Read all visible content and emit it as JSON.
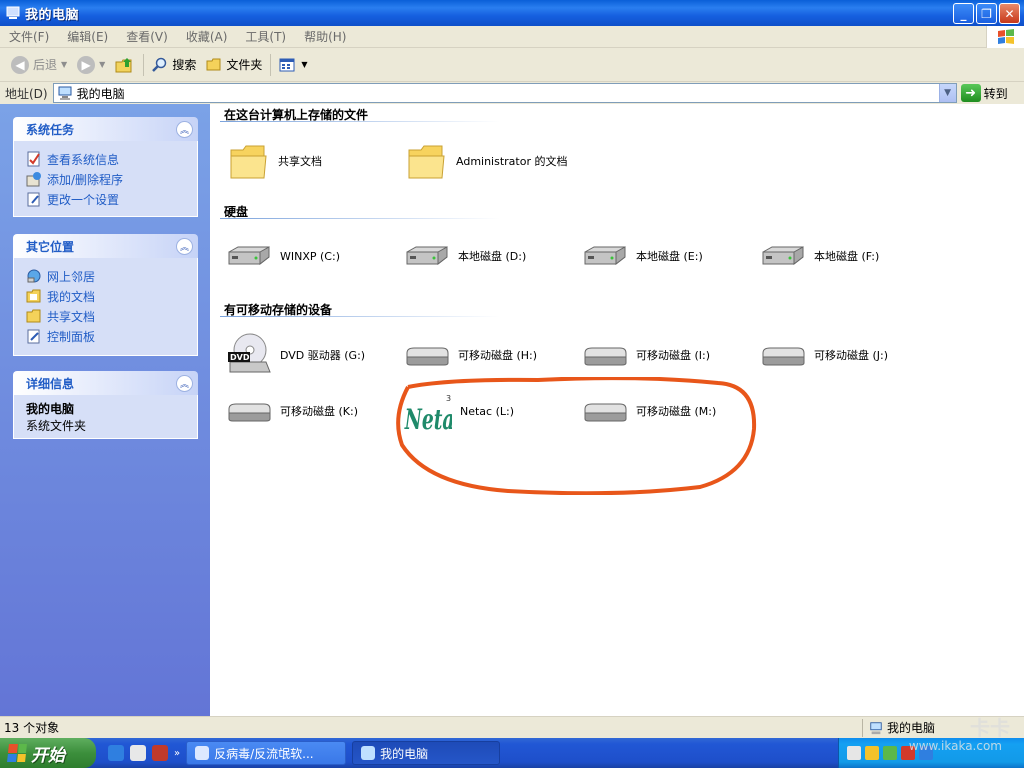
{
  "window": {
    "title": "我的电脑"
  },
  "menu": [
    "文件(F)",
    "编辑(E)",
    "查看(V)",
    "收藏(A)",
    "工具(T)",
    "帮助(H)"
  ],
  "toolbar": {
    "back": "后退",
    "search": "搜索",
    "folders": "文件夹"
  },
  "address": {
    "label": "地址(D)",
    "value": "我的电脑",
    "go": "转到"
  },
  "sidebar": {
    "system_tasks": {
      "title": "系统任务",
      "items": [
        "查看系统信息",
        "添加/删除程序",
        "更改一个设置"
      ]
    },
    "other_places": {
      "title": "其它位置",
      "items": [
        "网上邻居",
        "我的文档",
        "共享文档",
        "控制面板"
      ]
    },
    "details": {
      "title": "详细信息",
      "name": "我的电脑",
      "desc": "系统文件夹"
    }
  },
  "groups": {
    "stored_files": {
      "title": "在这台计算机上存储的文件",
      "items": [
        "共享文档",
        "Administrator 的文档"
      ]
    },
    "hard_disks": {
      "title": "硬盘",
      "items": [
        "WINXP (C:)",
        "本地磁盘 (D:)",
        "本地磁盘 (E:)",
        "本地磁盘 (F:)"
      ]
    },
    "removable": {
      "title": "有可移动存储的设备",
      "items": [
        "DVD 驱动器 (G:)",
        "可移动磁盘 (H:)",
        "可移动磁盘 (I:)",
        "可移动磁盘 (J:)",
        "可移动磁盘 (K:)",
        "Netac (L:)",
        "可移动磁盘 (M:)"
      ]
    }
  },
  "netac_logo": "Netac",
  "statusbar": {
    "left": "13 个对象",
    "right": "我的电脑"
  },
  "taskbar": {
    "start": "开始",
    "tasks": [
      "反病毒/反流氓软...",
      "我的电脑"
    ]
  },
  "watermark": {
    "brand": "卡卡",
    "url": "www.ikaka.com"
  },
  "colors": {
    "annotation": "#e8561a",
    "accent": "#215dc6"
  }
}
